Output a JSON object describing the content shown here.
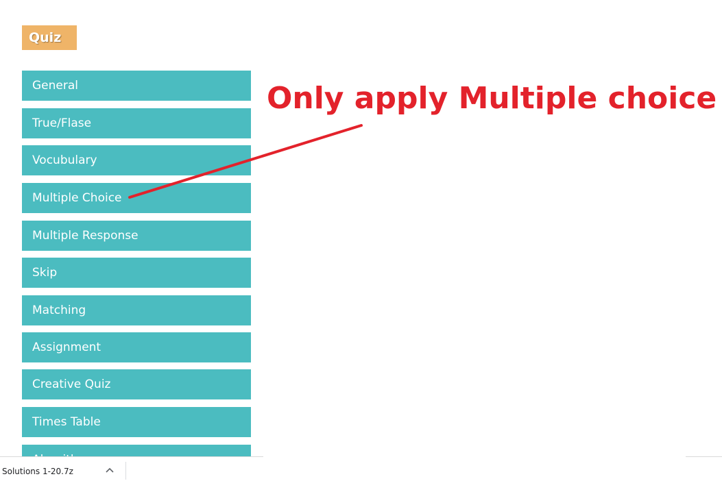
{
  "app": {
    "badge_label": "Quiz"
  },
  "menu": {
    "items": [
      {
        "label": "General"
      },
      {
        "label": "True/Flase"
      },
      {
        "label": "Vocubulary"
      },
      {
        "label": "Multiple Choice"
      },
      {
        "label": "Multiple Response"
      },
      {
        "label": "Skip"
      },
      {
        "label": "Matching"
      },
      {
        "label": "Assignment"
      },
      {
        "label": "Creative Quiz"
      },
      {
        "label": "Times Table"
      },
      {
        "label": "Algorithm"
      }
    ]
  },
  "annotation": {
    "text": "Only apply Multiple choice",
    "color": "#e3222b"
  },
  "download_bar": {
    "file_name": "Solutions 1-20.7z",
    "chevron_icon": "chevron-up-icon"
  },
  "colors": {
    "badge": "#efb468",
    "menu_item": "#4bbcc0",
    "annotation": "#e3222b"
  }
}
